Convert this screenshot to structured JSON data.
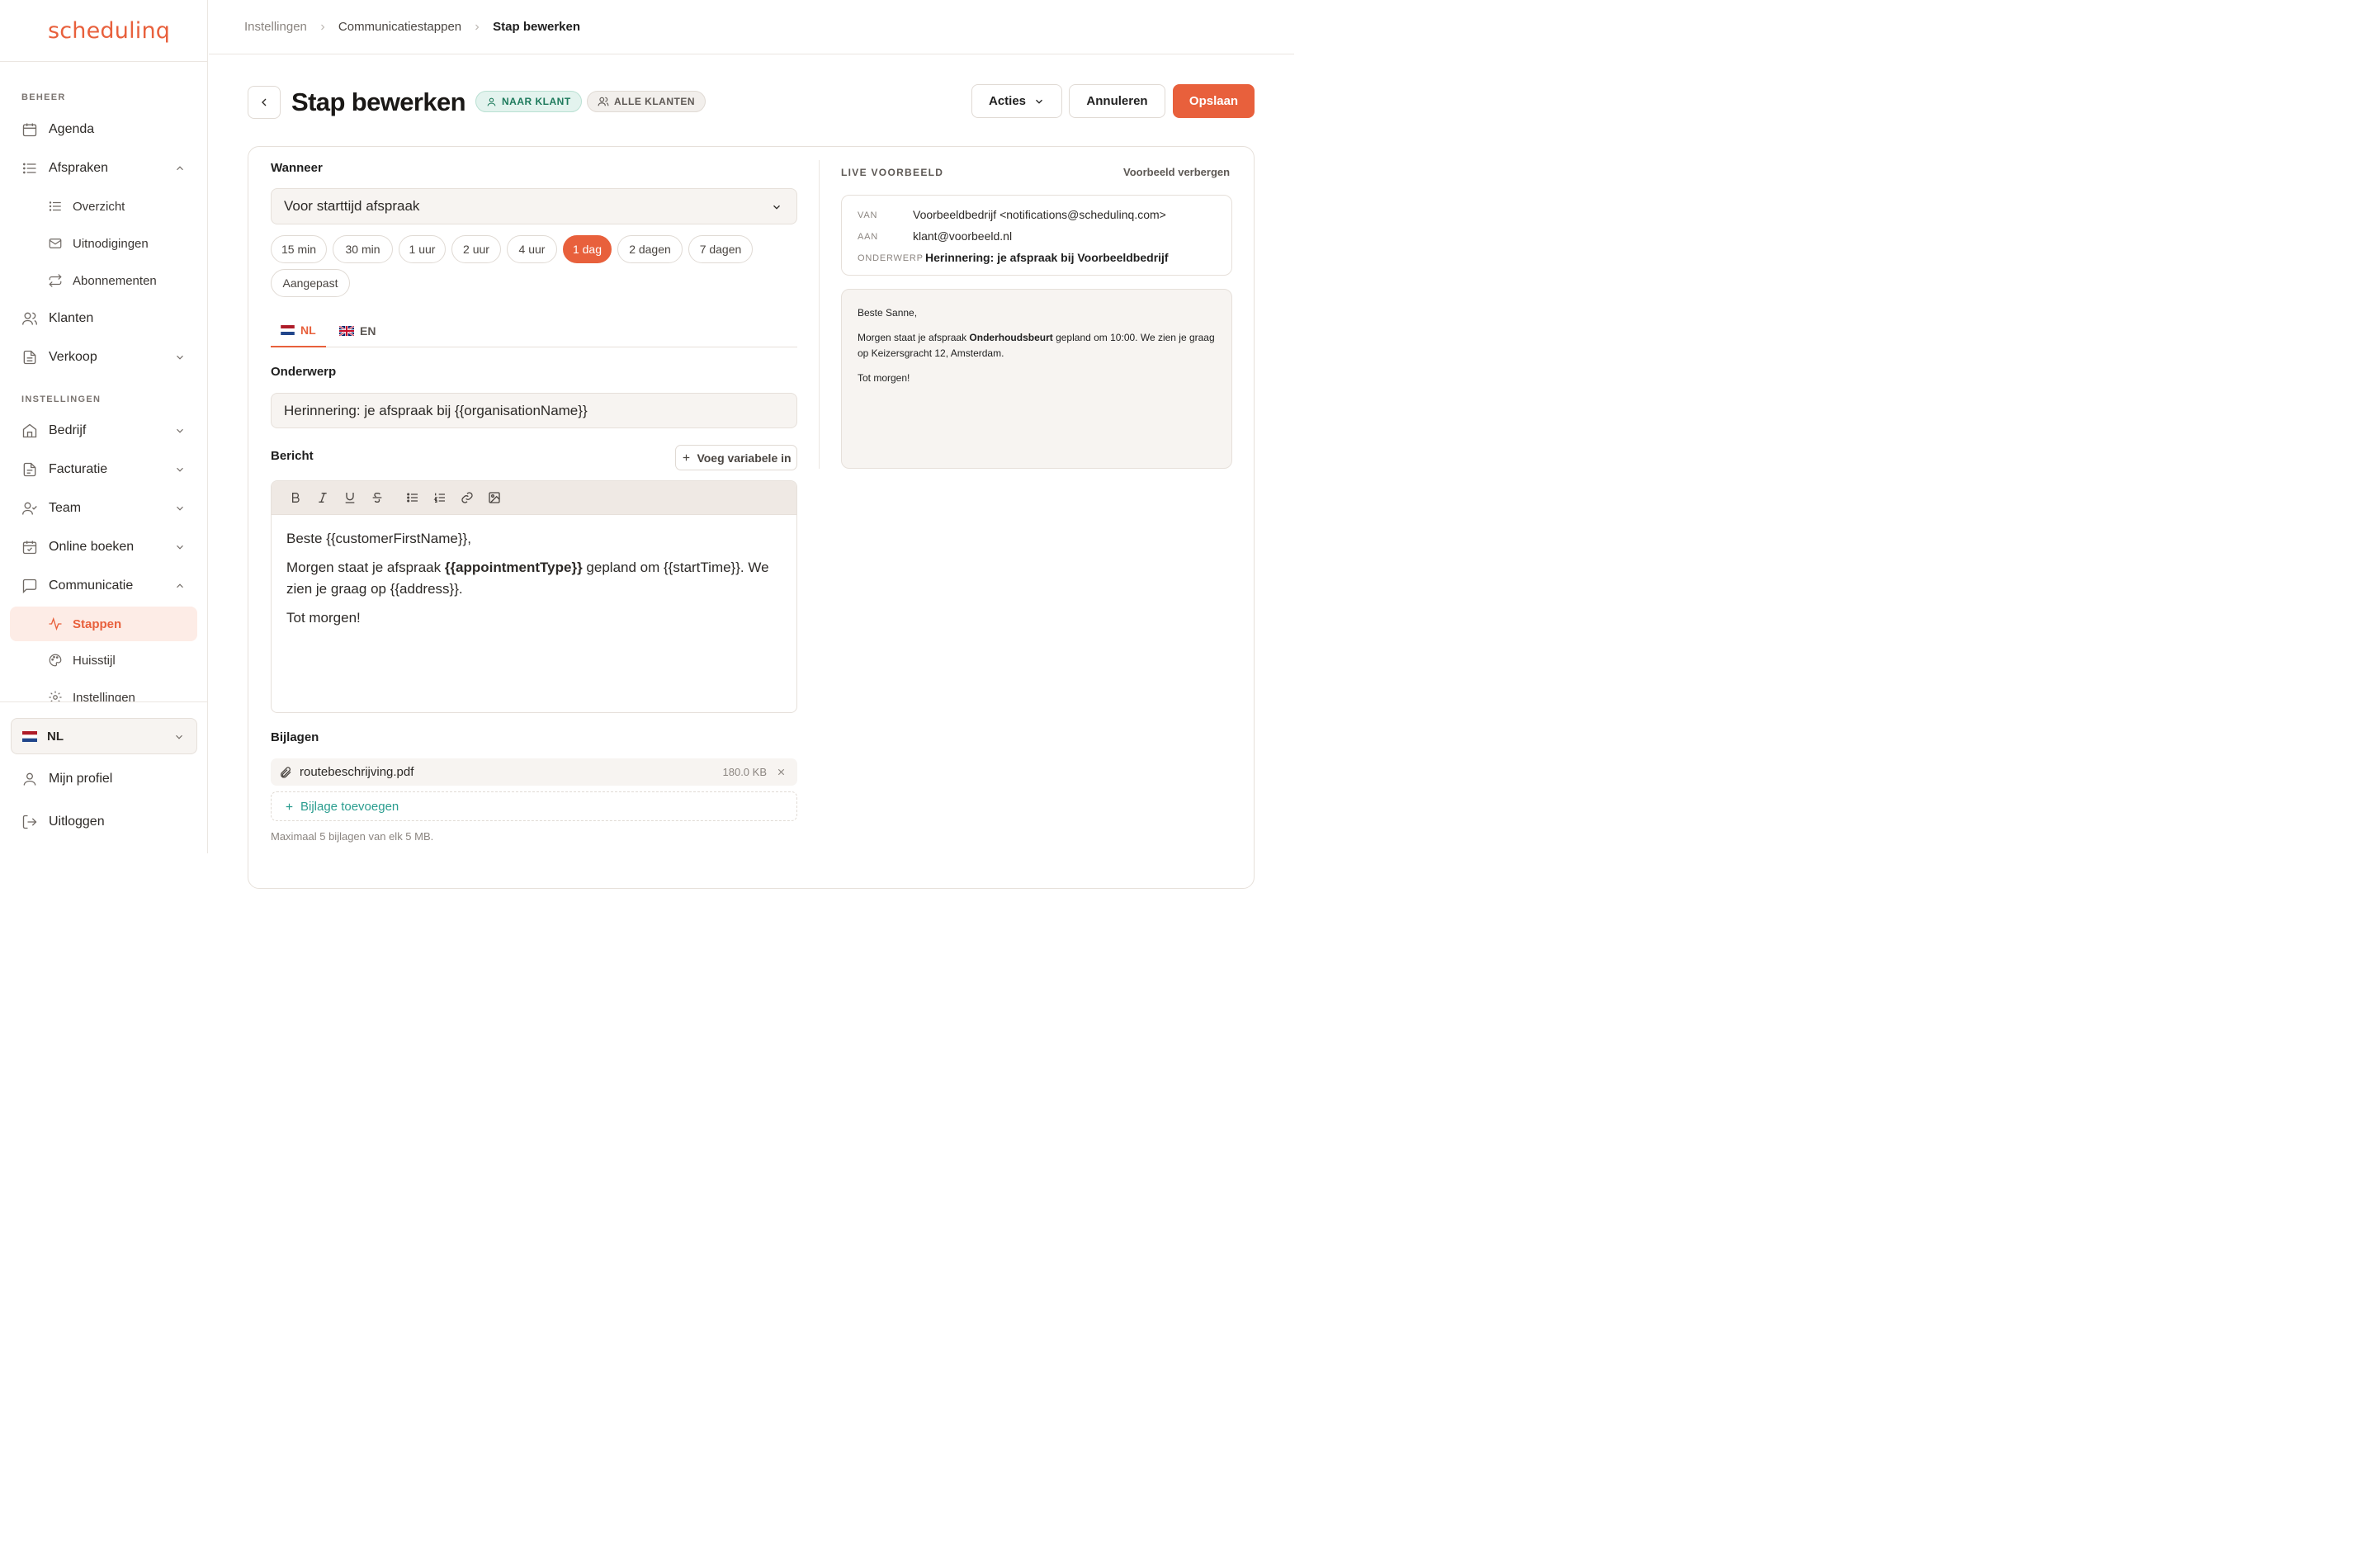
{
  "brand": {
    "logo": "schedulinq",
    "accent": "#e8603c",
    "teal": "#2a9d8f"
  },
  "sidebar": {
    "section_beheer": "BEHEER",
    "section_instellingen": "INSTELLINGEN",
    "items": {
      "agenda": "Agenda",
      "afspraken": "Afspraken",
      "overzicht": "Overzicht",
      "uitnodigingen": "Uitnodigingen",
      "abonnementen": "Abonnementen",
      "klanten": "Klanten",
      "verkoop": "Verkoop",
      "bedrijf": "Bedrijf",
      "facturatie": "Facturatie",
      "team": "Team",
      "online_boeken": "Online boeken",
      "communicatie": "Communicatie",
      "stappen": "Stappen",
      "huisstijl": "Huisstijl",
      "instellingen": "Instellingen"
    },
    "language": "NL",
    "profile": "Mijn profiel",
    "logout": "Uitloggen"
  },
  "breadcrumb": [
    "Instellingen",
    "Communicatiestappen",
    "Stap bewerken"
  ],
  "header": {
    "title": "Stap bewerken",
    "badge_client": "NAAR KLANT",
    "badge_all": "ALLE KLANTEN",
    "actions": "Acties",
    "cancel": "Annuleren",
    "save": "Opslaan"
  },
  "form": {
    "when_label": "Wanneer",
    "when_value": "Voor starttijd afspraak",
    "chips": [
      "15 min",
      "30 min",
      "1 uur",
      "2 uur",
      "4 uur",
      "1 dag",
      "2 dagen",
      "7 dagen",
      "Aangepast"
    ],
    "selected_chip": "1 dag",
    "tabs": [
      "NL",
      "EN"
    ],
    "active_tab": "NL",
    "subject_label": "Onderwerp",
    "subject_value": "Herinnering: je afspraak bij {{organisationName}}",
    "message_label": "Bericht",
    "insert_variable": "Voeg variabele in",
    "message": {
      "line1": "Beste {{customerFirstName}},",
      "line2_pre": "Morgen staat je afspraak ",
      "line2_bold": "{{appointmentType}}",
      "line2_post": " gepland om {{startTime}}. We zien je graag op {{address}}.",
      "line3": "Tot morgen!"
    },
    "attachments_label": "Bijlagen",
    "attachment": {
      "name": "routebeschrijving.pdf",
      "size": "180.0 KB"
    },
    "add_attachment": "Bijlage toevoegen",
    "attachments_hint": "Maximaal 5 bijlagen van elk 5 MB."
  },
  "preview": {
    "label": "LIVE VOORBEELD",
    "hide": "Voorbeeld verbergen",
    "from_key": "VAN",
    "from_value": "Voorbeeldbedrijf <notifications@schedulinq.com>",
    "to_key": "AAN",
    "to_value": "klant@voorbeeld.nl",
    "subject_key": "ONDERWERP",
    "subject_value": "Herinnering: je afspraak bij Voorbeeldbedrijf",
    "body": {
      "greeting": "Beste Sanne,",
      "line_pre": "Morgen staat je afspraak ",
      "line_bold": "Onderhoudsbeurt",
      "line_post": " gepland om 10:00. We zien je graag op Keizersgracht 12, Amsterdam.",
      "closing": "Tot morgen!"
    }
  }
}
